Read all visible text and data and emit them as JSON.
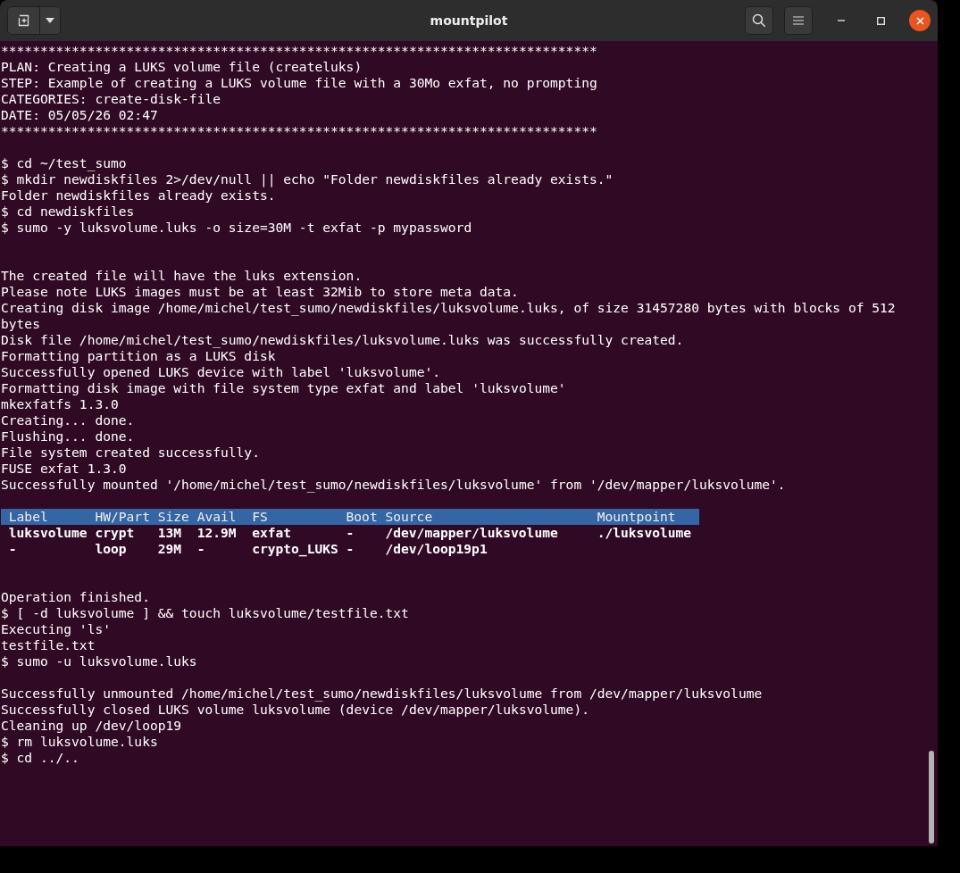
{
  "window": {
    "title": "mountpilot"
  },
  "terminal": {
    "lines": [
      {
        "kind": "text",
        "text": "****************************************************************************"
      },
      {
        "kind": "text",
        "text": "PLAN: Creating a LUKS volume file (createluks)"
      },
      {
        "kind": "text",
        "text": "STEP: Example of creating a LUKS volume file with a 30Mo exfat, no prompting"
      },
      {
        "kind": "text",
        "text": "CATEGORIES: create-disk-file"
      },
      {
        "kind": "text",
        "text": "DATE: 05/05/26 02:47"
      },
      {
        "kind": "text",
        "text": "****************************************************************************"
      },
      {
        "kind": "blank"
      },
      {
        "kind": "text",
        "text": "$ cd ~/test_sumo"
      },
      {
        "kind": "text",
        "text": "$ mkdir newdiskfiles 2>/dev/null || echo \"Folder newdiskfiles already exists.\""
      },
      {
        "kind": "text",
        "text": "Folder newdiskfiles already exists."
      },
      {
        "kind": "text",
        "text": "$ cd newdiskfiles"
      },
      {
        "kind": "text",
        "text": "$ sumo -y luksvolume.luks -o size=30M -t exfat -p mypassword"
      },
      {
        "kind": "blank"
      },
      {
        "kind": "blank"
      },
      {
        "kind": "text",
        "text": "The created file will have the luks extension."
      },
      {
        "kind": "text",
        "text": "Please note LUKS images must be at least 32Mib to store meta data."
      },
      {
        "kind": "text",
        "text": "Creating disk image /home/michel/test_sumo/newdiskfiles/luksvolume.luks, of size 31457280 bytes with blocks of 512 bytes"
      },
      {
        "kind": "text",
        "text": "Disk file /home/michel/test_sumo/newdiskfiles/luksvolume.luks was successfully created."
      },
      {
        "kind": "text",
        "text": "Formatting partition as a LUKS disk"
      },
      {
        "kind": "text",
        "text": "Successfully opened LUKS device with label 'luksvolume'."
      },
      {
        "kind": "text",
        "text": "Formatting disk image with file system type exfat and label 'luksvolume'"
      },
      {
        "kind": "text",
        "text": "mkexfatfs 1.3.0"
      },
      {
        "kind": "text",
        "text": "Creating... done."
      },
      {
        "kind": "text",
        "text": "Flushing... done."
      },
      {
        "kind": "text",
        "text": "File system created successfully."
      },
      {
        "kind": "text",
        "text": "FUSE exfat 1.3.0"
      },
      {
        "kind": "text",
        "text": "Successfully mounted '/home/michel/test_sumo/newdiskfiles/luksvolume' from '/dev/mapper/luksvolume'."
      },
      {
        "kind": "blank"
      },
      {
        "kind": "table",
        "columns": [
          "Label",
          "HW/Part",
          "Size",
          "Avail",
          "FS",
          "Boot",
          "Source",
          "Mountpoint"
        ],
        "rows": [
          [
            "luksvolume",
            "crypt",
            "13M",
            "12.9M",
            "exfat",
            "-",
            "/dev/mapper/luksvolume",
            "./luksvolume"
          ],
          [
            "-",
            "loop",
            "29M",
            "-",
            "crypto_LUKS",
            "-",
            "/dev/loop19p1"
          ]
        ]
      },
      {
        "kind": "blank"
      },
      {
        "kind": "blank"
      },
      {
        "kind": "text",
        "text": "Operation finished."
      },
      {
        "kind": "text",
        "text": "$ [ -d luksvolume ] && touch luksvolume/testfile.txt"
      },
      {
        "kind": "text",
        "text": "Executing 'ls'"
      },
      {
        "kind": "text",
        "text": "testfile.txt"
      },
      {
        "kind": "text",
        "text": "$ sumo -u luksvolume.luks"
      },
      {
        "kind": "blank"
      },
      {
        "kind": "text",
        "text": "Successfully unmounted /home/michel/test_sumo/newdiskfiles/luksvolume from /dev/mapper/luksvolume"
      },
      {
        "kind": "text",
        "text": "Successfully closed LUKS volume luksvolume (device /dev/mapper/luksvolume)."
      },
      {
        "kind": "text",
        "text": "Cleaning up /dev/loop19"
      },
      {
        "kind": "text",
        "text": "$ rm luksvolume.luks"
      },
      {
        "kind": "text",
        "text": "$ cd ../.."
      }
    ]
  }
}
